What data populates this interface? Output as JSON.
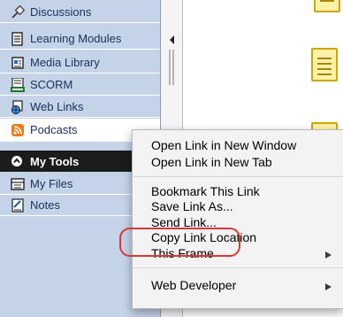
{
  "sidebar": {
    "items": [
      {
        "label": "Discussions",
        "icon": "pin-icon"
      },
      {
        "label": "Learning Modules",
        "icon": "document-icon"
      },
      {
        "label": "Media Library",
        "icon": "media-library-icon"
      },
      {
        "label": "SCORM",
        "icon": "scorm-icon"
      },
      {
        "label": "Web Links",
        "icon": "globe-icon"
      },
      {
        "label": "Podcasts",
        "icon": "rss-icon"
      }
    ],
    "tools_section": {
      "label": "My Tools",
      "icon": "collapse-icon"
    },
    "tools": [
      {
        "label": "My Files",
        "icon": "files-icon"
      },
      {
        "label": "Notes",
        "icon": "notes-icon"
      }
    ]
  },
  "context_menu": {
    "items": [
      "Open Link in New Window",
      "Open Link in New Tab",
      "Bookmark This Link",
      "Save Link As...",
      "Send Link...",
      "Copy Link Location",
      "This Frame",
      "Web Developer"
    ],
    "highlighted": "Copy Link Location"
  },
  "colors": {
    "sidebar_bg": "#c5d3e8",
    "section_head_bg": "#1c1c1c",
    "highlight_ring": "#e03535",
    "rss_orange": "#f07a1a"
  }
}
